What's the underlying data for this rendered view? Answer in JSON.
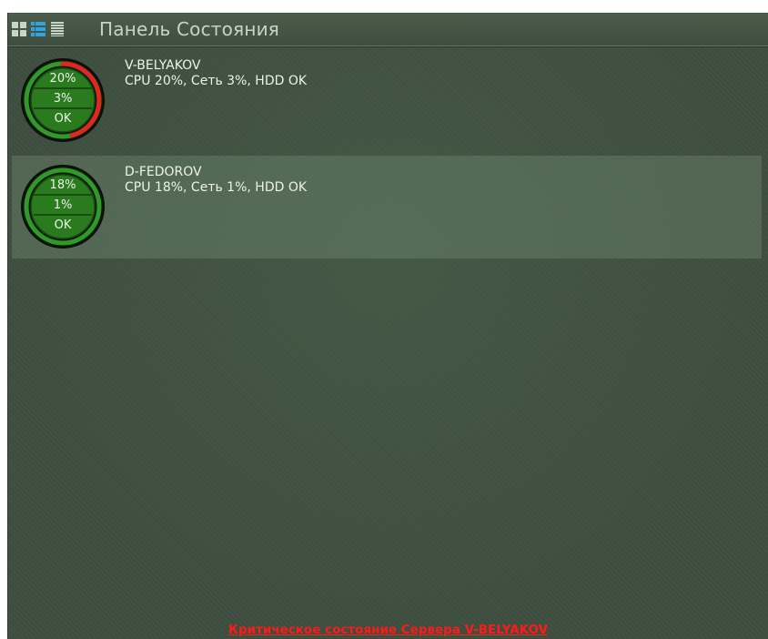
{
  "header": {
    "title": "Панель Состояния",
    "view_modes": [
      {
        "icon": "grid-view-icon",
        "active": false
      },
      {
        "icon": "list-view-icon",
        "active": true
      },
      {
        "icon": "compact-list-icon",
        "active": false
      }
    ]
  },
  "servers": [
    {
      "name": "V-BELYAKOV",
      "status": "CPU 20%, Сеть 3%, HDD OK",
      "gauge": {
        "cpu": "20%",
        "net": "3%",
        "hdd": "OK",
        "ring_color": "#e0281e",
        "ring_fraction": 0.45
      },
      "selected": false
    },
    {
      "name": "D-FEDOROV",
      "status": "CPU 18%, Сеть 1%, HDD OK",
      "gauge": {
        "cpu": "18%",
        "net": "1%",
        "hdd": "OK",
        "ring_color": "#3aa43a",
        "ring_fraction": 0.0
      },
      "selected": true
    }
  ],
  "alert": "Критическое состояние Сервера V-BELYAKOV",
  "colors": {
    "accent_blue": "#2fa3e6",
    "panel_bg": "#3e4e3f",
    "alert_red": "#ff1a1a",
    "gauge_green": "#2f8f24"
  }
}
